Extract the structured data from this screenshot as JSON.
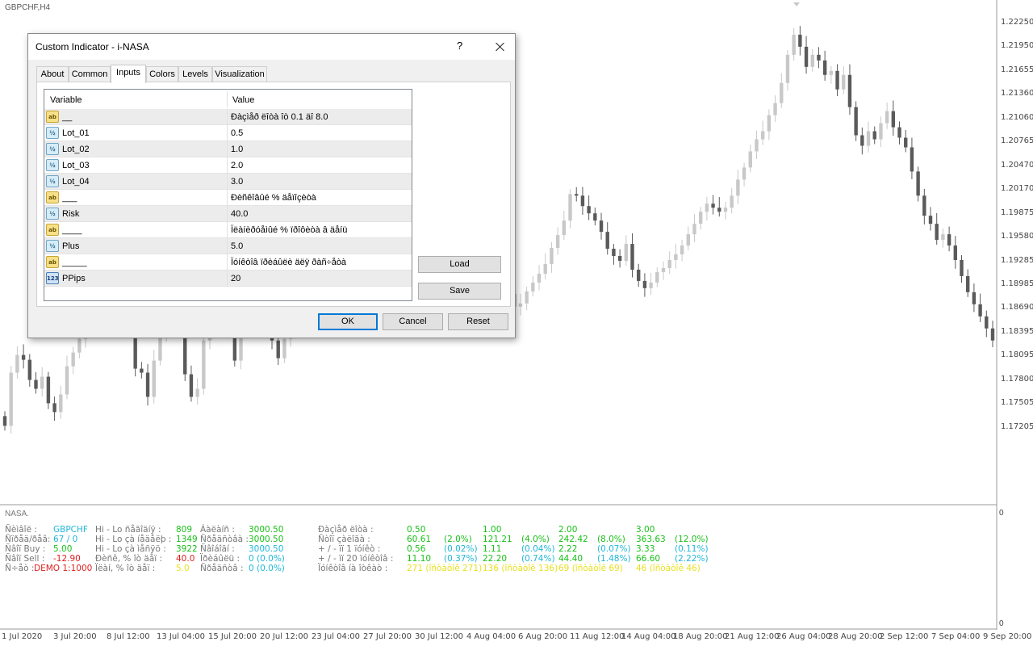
{
  "chart": {
    "symbol": "GBPCHF,H4",
    "price_labels": [
      "1.22250",
      "1.21950",
      "1.21655",
      "1.21360",
      "1.21060",
      "1.20765",
      "1.20470",
      "1.20170",
      "1.19875",
      "1.19580",
      "1.19285",
      "1.18985",
      "1.18690",
      "1.18395",
      "1.18095",
      "1.17800",
      "1.17505",
      "1.17205"
    ],
    "date_labels": [
      "1 Jul 2020",
      "3 Jul 20:00",
      "8 Jul 12:00",
      "13 Jul 04:00",
      "15 Jul 20:00",
      "20 Jul 12:00",
      "23 Jul 04:00",
      "27 Jul 20:00",
      "30 Jul 12:00",
      "4 Aug 04:00",
      "6 Aug 20:00",
      "11 Aug 12:00",
      "14 Aug 04:00",
      "18 Aug 20:00",
      "21 Aug 12:00",
      "26 Aug 04:00",
      "28 Aug 20:00",
      "2 Sep 12:00",
      "7 Sep 04:00",
      "9 Sep 20:00"
    ],
    "bull_color": "#c8c8c8",
    "bear_color": "#5a5a5a",
    "closes": [
      1.1724,
      1.179,
      1.1812,
      1.1806,
      1.1781,
      1.177,
      1.1785,
      1.1752,
      1.1741,
      1.1763,
      1.1798,
      1.1815,
      1.1832,
      1.1846,
      1.186,
      1.1872,
      1.1889,
      1.1898,
      1.188,
      1.1877,
      1.184,
      1.1795,
      1.179,
      1.176,
      1.1805,
      1.1838,
      1.1882,
      1.187,
      1.1852,
      1.1788,
      1.176,
      1.177,
      1.183,
      1.1855,
      1.1881,
      1.1885,
      1.185,
      1.1805,
      1.1842,
      1.1868,
      1.1881,
      1.1898,
      1.1872,
      1.183,
      1.1808,
      1.1832,
      1.1862,
      1.1875,
      1.1901,
      1.1912,
      1.1928,
      1.1932,
      1.194,
      1.1935,
      1.191,
      1.1925,
      1.1944,
      1.1962,
      1.1975,
      1.198,
      1.1987,
      1.1972,
      1.1958,
      1.1962,
      1.1976,
      1.1981,
      1.1975,
      1.1966,
      1.1951,
      1.1962,
      1.1981,
      1.199,
      1.1995,
      1.1987,
      1.1962,
      1.194,
      1.1915,
      1.189,
      1.1887,
      1.189,
      1.19,
      1.1888,
      1.1872,
      1.1876,
      1.1891,
      1.1902,
      1.1913,
      1.1925,
      1.1945,
      1.1961,
      1.1979,
      1.2012,
      1.201,
      1.1997,
      1.1988,
      1.1979,
      1.1965,
      1.1944,
      1.1935,
      1.1929,
      1.195,
      1.1918,
      1.1904,
      1.1895,
      1.1902,
      1.1915,
      1.192,
      1.193,
      1.1937,
      1.1948,
      1.1962,
      1.1975,
      1.199,
      1.2,
      1.1995,
      1.199,
      1.1995,
      1.201,
      1.203,
      1.2045,
      1.2065,
      1.208,
      1.209,
      1.211,
      1.2125,
      1.215,
      1.2185,
      1.221,
      1.2195,
      1.217,
      1.2185,
      1.2178,
      1.216,
      1.2165,
      1.2142,
      1.216,
      1.212,
      1.2085,
      1.2072,
      1.209,
      1.208,
      1.21,
      1.2115,
      1.2095,
      1.2082,
      1.207,
      1.204,
      1.201,
      1.1985,
      1.1975,
      1.1955,
      1.1962,
      1.1948,
      1.193,
      1.191,
      1.189,
      1.1875,
      1.186,
      1.1845,
      1.183
    ]
  },
  "subwindow": {
    "title": "NASA.",
    "scale_top": "0",
    "scale_bottom": "0",
    "col1": [
      {
        "label": "Ñèìâîë :",
        "value": "GBPCHF",
        "color": "#20b8d8"
      },
      {
        "label": "Ñïðåä/ðåâ:",
        "value": "67 / 0",
        "color": "#20b8d8"
      },
      {
        "label": "Ñâîï Buy :",
        "value": "5.00",
        "color": "#18c018"
      },
      {
        "label": "Ñâîï Sell :",
        "value": "-12.90",
        "color": "#e02020"
      },
      {
        "label": "Ñ÷åò :",
        "value": "DEMO 1:1000",
        "color": "#e02020"
      }
    ],
    "col2": [
      {
        "label": "Hi - Lo ñåãîäíÿ :",
        "value": "809",
        "color": "#18c018"
      },
      {
        "label": "Hi - Lo çà íåäåëþ :",
        "value": "1349",
        "color": "#18c018"
      },
      {
        "label": "Hi - Lo çà ìåñÿö :",
        "value": "3922",
        "color": "#18c018"
      },
      {
        "label": "Ðèñê, % îò äåï :",
        "value": "40.0",
        "color": "#e02020"
      },
      {
        "label": "Ïëàí, % îò äåï :",
        "value": "5.0",
        "color": "#e8e020"
      }
    ],
    "col3": [
      {
        "label": "Áàëàíñ :",
        "value": "3000.50",
        "color": "#18c018"
      },
      {
        "label": "Ñðåäñòâà :",
        "value": "3000.50",
        "color": "#18c018"
      },
      {
        "label": "Ñâîáîäí :",
        "value": "3000.50",
        "color": "#20b8d8"
      },
      {
        "label": "Ïðèáûëü :",
        "value": "0 (0.0%)",
        "color": "#20b8d8"
      },
      {
        "label": "Ñðåäñòâ :",
        "value": "0 (0.0%)",
        "color": "#20b8d8"
      }
    ],
    "col4_labels": [
      "Ðàçìåð ëîòà :",
      "Ñòîï çàëîãà :",
      "+ / -  ïï 1 ïóíêò :",
      "+ / -  ïï 20 ïóíêòîâ :",
      "Ïóíêòîâ íà îòêàò :"
    ],
    "lots": [
      {
        "size": "3.00",
        "margin": "363.63",
        "margin_pct": "(12.0%)",
        "pip1": "3.33",
        "pip1_pct": "(0.11%)",
        "pip20": "66.60",
        "pip20_pct": "(2.22%)",
        "pts": "46 (îñòàòîê 46)"
      },
      {
        "size": "0.50",
        "margin": "60.61",
        "margin_pct": "(2.0%)",
        "pip1": "0.56",
        "pip1_pct": "(0.02%)",
        "pip20": "11.10",
        "pip20_pct": "(0.37%)",
        "pts": "271 (îñòàòîê 271)"
      },
      {
        "size": "1.00",
        "margin": "121.21",
        "margin_pct": "(4.0%)",
        "pip1": "1.11",
        "pip1_pct": "(0.04%)",
        "pip20": "22.20",
        "pip20_pct": "(0.74%)",
        "pts": "136 (îñòàòîê 136)"
      },
      {
        "size": "2.00",
        "margin": "242.42",
        "margin_pct": "(8.0%)",
        "pip1": "2.22",
        "pip1_pct": "(0.07%)",
        "pip20": "44.40",
        "pip20_pct": "(1.48%)",
        "pts": "69 (îñòàòîê 69)"
      }
    ],
    "green": "#18c018",
    "cyan": "#20b8d8",
    "yellow": "#e8e020"
  },
  "dialog": {
    "title": "Custom Indicator - i-NASA",
    "help": "?",
    "tabs": [
      "About",
      "Common",
      "Inputs",
      "Colors",
      "Levels",
      "Visualization"
    ],
    "active_tab": "Inputs",
    "col_variable": "Variable",
    "col_value": "Value",
    "rows": [
      {
        "icon": "ab",
        "icon_name": "string-icon",
        "variable": "__",
        "value": "Ðàçìåð ëîòà îò 0.1 äî 8.0"
      },
      {
        "icon": "½",
        "icon_name": "double-icon",
        "variable": "Lot_01",
        "value": "0.5"
      },
      {
        "icon": "½",
        "icon_name": "double-icon",
        "variable": "Lot_02",
        "value": "1.0"
      },
      {
        "icon": "½",
        "icon_name": "double-icon",
        "variable": "Lot_03",
        "value": "2.0"
      },
      {
        "icon": "½",
        "icon_name": "double-icon",
        "variable": "Lot_04",
        "value": "3.0"
      },
      {
        "icon": "ab",
        "icon_name": "string-icon",
        "variable": "___",
        "value": "Ðèñêîâûé % äåïîçèòà"
      },
      {
        "icon": "½",
        "icon_name": "double-icon",
        "variable": "Risk",
        "value": "40.0"
      },
      {
        "icon": "ab",
        "icon_name": "string-icon",
        "variable": "____",
        "value": "Ïëàíèðóåìûé % ïðîôèòà â äåíü"
      },
      {
        "icon": "½",
        "icon_name": "double-icon",
        "variable": "Plus",
        "value": "5.0"
      },
      {
        "icon": "ab",
        "icon_name": "string-icon",
        "variable": "_____",
        "value": "Ïóíêòîâ ïðèáûëè äëÿ ðàñ÷åòà"
      },
      {
        "icon": "123",
        "icon_name": "integer-icon",
        "variable": "PPips",
        "value": "20"
      }
    ],
    "load": "Load",
    "save": "Save",
    "ok": "OK",
    "cancel": "Cancel",
    "reset": "Reset"
  }
}
